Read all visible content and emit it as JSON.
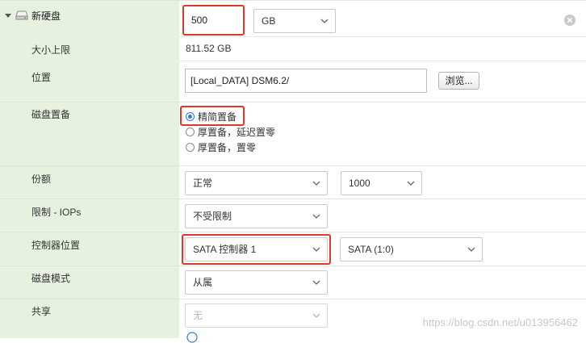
{
  "disk": {
    "title": "新硬盘",
    "size_value": "500",
    "size_unit": "GB"
  },
  "rows": {
    "max_size": {
      "label": "大小上限",
      "value": "811.52 GB"
    },
    "location": {
      "label": "位置",
      "value": "[Local_DATA] DSM6.2/",
      "browse": "浏览..."
    },
    "provisioning": {
      "label": "磁盘置备",
      "options": [
        "精简置备",
        "厚置备，延迟置零",
        "厚置备，置零"
      ],
      "selected_index": 0
    },
    "shares": {
      "label": "份额",
      "value": "正常",
      "number": "1000"
    },
    "iops": {
      "label": "限制 - IOPs",
      "value": "不受限制"
    },
    "controller": {
      "label": "控制器位置",
      "value": "SATA 控制器 1",
      "port": "SATA (1:0)"
    },
    "mode": {
      "label": "磁盘模式",
      "value": "从属"
    },
    "sharing": {
      "label": "共享",
      "value": "无"
    }
  },
  "watermark": "https://blog.csdn.net/u013956462",
  "colors": {
    "highlight": "#d83b2d",
    "label_column": "#e7f1e0",
    "radio_accent": "#2c7be5"
  },
  "icons": [
    "caret-down-icon",
    "hard-disk-icon",
    "remove-circle-icon",
    "chevron-down-icon"
  ]
}
